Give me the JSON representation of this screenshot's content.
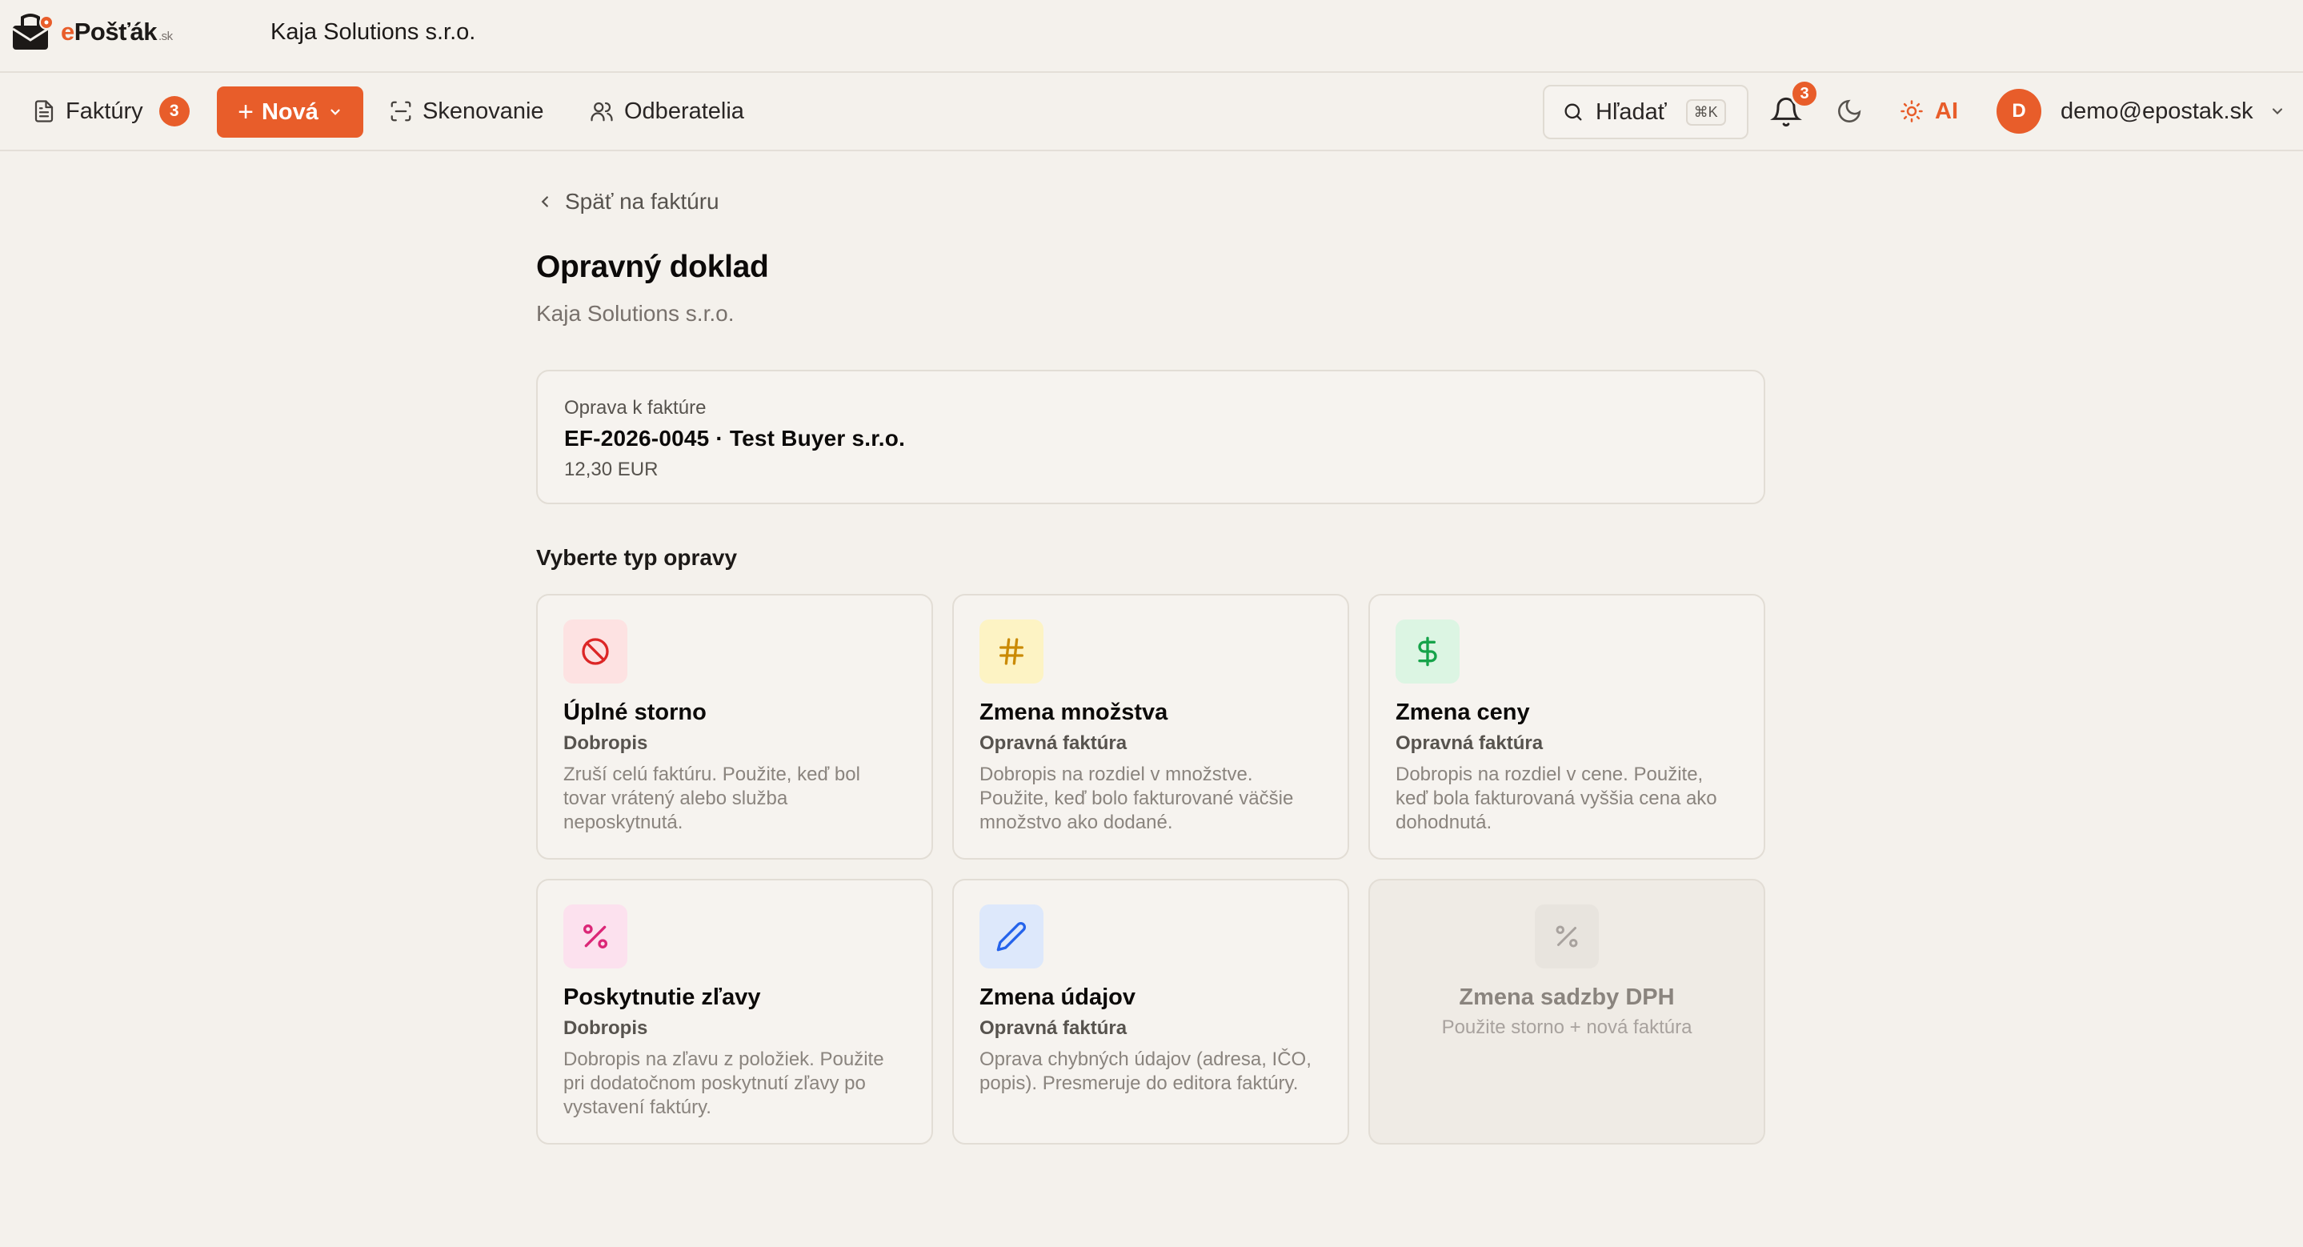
{
  "header": {
    "logo_prefix": "e",
    "logo_main": "Pošťák",
    "logo_tld": ".sk",
    "company": "Kaja Solutions s.r.o."
  },
  "nav": {
    "invoices_label": "Faktúry",
    "invoices_badge": "3",
    "new_label": "Nová",
    "scan_label": "Skenovanie",
    "customers_label": "Odberatelia",
    "search_label": "Hľadať",
    "search_shortcut": "⌘K",
    "notifications_badge": "3",
    "ai_label": "AI",
    "user_initial": "D",
    "user_email": "demo@epostak.sk"
  },
  "page": {
    "back_label": "Späť na faktúru",
    "title": "Opravný doklad",
    "subtitle": "Kaja Solutions s.r.o."
  },
  "invoice": {
    "label": "Oprava k faktúre",
    "number_line": "EF-2026-0045 · Test Buyer s.r.o.",
    "amount": "12,30 EUR"
  },
  "section_title": "Vyberte typ opravy",
  "options": [
    {
      "name": "Úplné storno",
      "type": "Dobropis",
      "description": "Zruší celú faktúru. Použite, keď bol tovar vrátený alebo služba neposkytnutá.",
      "icon": "ban-icon",
      "color": "#dc2626",
      "bg": "#fde2e2"
    },
    {
      "name": "Zmena množstva",
      "type": "Opravná faktúra",
      "description": "Dobropis na rozdiel v množstve. Použite, keď bolo fakturované väčšie množstvo ako dodané.",
      "icon": "hash-icon",
      "color": "#ca8a04",
      "bg": "#fdf3c4"
    },
    {
      "name": "Zmena ceny",
      "type": "Opravná faktúra",
      "description": "Dobropis na rozdiel v cene. Použite, keď bola fakturovaná vyššia cena ako dohodnutá.",
      "icon": "dollar-icon",
      "color": "#16a34a",
      "bg": "#dcf5e3"
    },
    {
      "name": "Poskytnutie zľavy",
      "type": "Dobropis",
      "description": "Dobropis na zľavu z položiek. Použite pri dodatočnom poskytnutí zľavy po vystavení faktúry.",
      "icon": "percent-icon",
      "color": "#db2777",
      "bg": "#fce1ee"
    },
    {
      "name": "Zmena údajov",
      "type": "Opravná faktúra",
      "description": "Oprava chybných údajov (adresa, IČO, popis). Presmeruje do editora faktúry.",
      "icon": "pencil-icon",
      "color": "#2563eb",
      "bg": "#dde8fb"
    }
  ],
  "disabled_option": {
    "name": "Zmena sadzby DPH",
    "description": "Použite storno + nová faktúra",
    "icon": "percent-icon"
  }
}
